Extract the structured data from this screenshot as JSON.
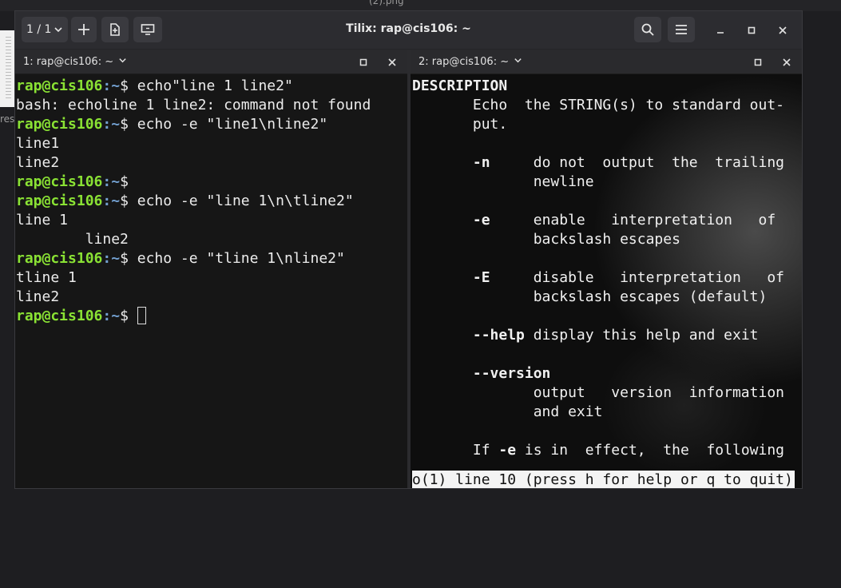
{
  "background": {
    "top_text": "(2).png",
    "left_label": "res"
  },
  "window": {
    "title": "Tilix: rap@cis106: ~",
    "session_label": "1 / 1"
  },
  "terminals": [
    {
      "title": "1: rap@cis106: ~",
      "prompt": {
        "user": "rap@cis106",
        "path": ":~",
        "symbol": "$ "
      },
      "lines": [
        {
          "type": "prompt",
          "cmd": "echo\"line 1 line2\""
        },
        {
          "type": "out",
          "text": "bash: echoline 1 line2: command not found"
        },
        {
          "type": "prompt",
          "cmd": "echo -e \"line1\\nline2\""
        },
        {
          "type": "out",
          "text": "line1"
        },
        {
          "type": "out",
          "text": "line2"
        },
        {
          "type": "prompt",
          "cmd": ""
        },
        {
          "type": "prompt",
          "cmd": "echo -e \"line 1\\n\\tline2\""
        },
        {
          "type": "out",
          "text": "line 1"
        },
        {
          "type": "out",
          "text": "        line2"
        },
        {
          "type": "prompt",
          "cmd": "echo -e \"tline 1\\nline2\""
        },
        {
          "type": "out",
          "text": "tline 1"
        },
        {
          "type": "out",
          "text": "line2"
        },
        {
          "type": "prompt",
          "cmd": "",
          "cursor": true
        }
      ]
    },
    {
      "title": "2: rap@cis106: ~",
      "man_lines": [
        [
          {
            "t": "DESCRIPTION",
            "b": true
          }
        ],
        [
          {
            "t": "       Echo  the STRING(s) to standard out-"
          }
        ],
        [
          {
            "t": "       put."
          }
        ],
        [
          {
            "t": ""
          }
        ],
        [
          {
            "t": "       "
          },
          {
            "t": "-n",
            "b": true
          },
          {
            "t": "     do not  output  the  trailing"
          }
        ],
        [
          {
            "t": "              newline"
          }
        ],
        [
          {
            "t": ""
          }
        ],
        [
          {
            "t": "       "
          },
          {
            "t": "-e",
            "b": true
          },
          {
            "t": "     enable   interpretation   of"
          }
        ],
        [
          {
            "t": "              backslash escapes"
          }
        ],
        [
          {
            "t": ""
          }
        ],
        [
          {
            "t": "       "
          },
          {
            "t": "-E",
            "b": true
          },
          {
            "t": "     disable   interpretation   of"
          }
        ],
        [
          {
            "t": "              backslash escapes (default)"
          }
        ],
        [
          {
            "t": ""
          }
        ],
        [
          {
            "t": "       "
          },
          {
            "t": "--help",
            "b": true
          },
          {
            "t": " display this help and exit"
          }
        ],
        [
          {
            "t": ""
          }
        ],
        [
          {
            "t": "       "
          },
          {
            "t": "--version",
            "b": true
          }
        ],
        [
          {
            "t": "              output   version  information"
          }
        ],
        [
          {
            "t": "              and exit"
          }
        ],
        [
          {
            "t": ""
          }
        ],
        [
          {
            "t": "       If "
          },
          {
            "t": "-e",
            "b": true
          },
          {
            "t": " is in  effect,  the  following"
          }
        ]
      ],
      "status_line": "o(1) line 10 (press h for help or q to quit)"
    }
  ]
}
